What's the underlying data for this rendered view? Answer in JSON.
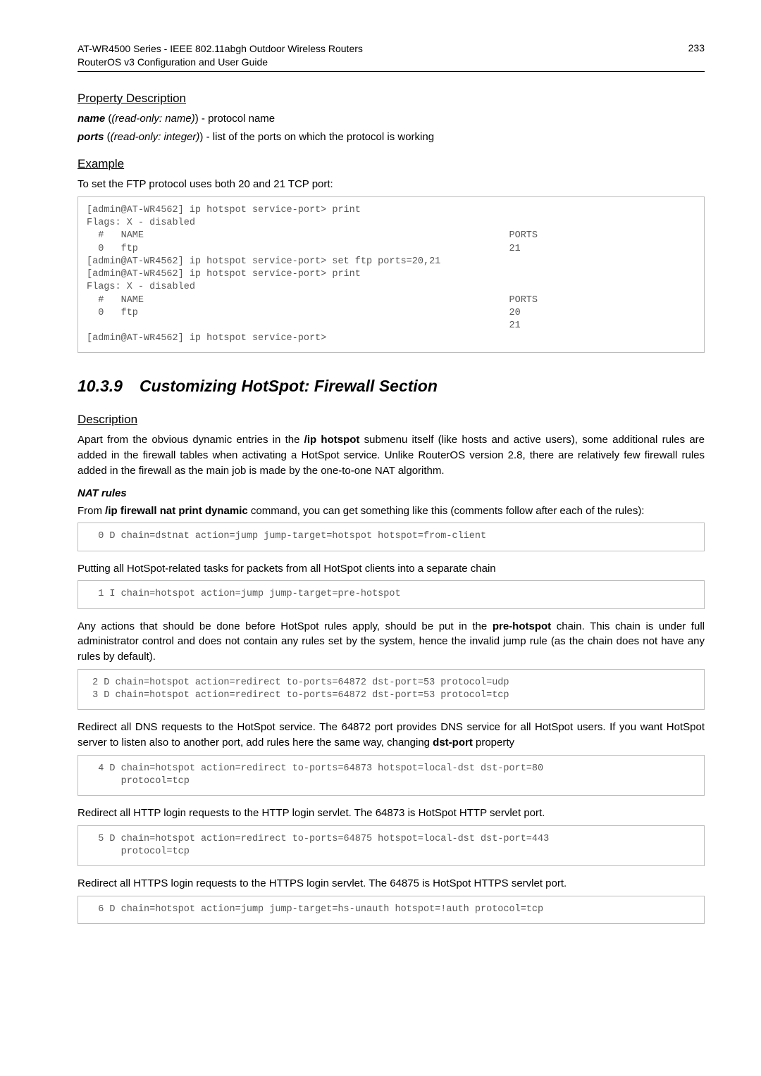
{
  "header": {
    "title_line1": "AT-WR4500 Series - IEEE 802.11abgh Outdoor Wireless Routers",
    "title_line2": "RouterOS v3 Configuration and User Guide",
    "page_number": "233"
  },
  "sec_propdesc": {
    "title": "Property Description",
    "line1_name": "name",
    "line1_paren": "(read-only: name)",
    "line1_rest": " - protocol name",
    "line2_name": "ports",
    "line2_paren": "(read-only: integer)",
    "line2_rest": " - list of the ports on which the protocol is working"
  },
  "sec_example": {
    "title": "Example",
    "intro": "To set the FTP protocol uses both 20 and 21 TCP port:",
    "code": "[admin@AT-WR4562] ip hotspot service-port> print\nFlags: X - disabled\n  #   NAME                                                                PORTS\n  0   ftp                                                                 21\n[admin@AT-WR4562] ip hotspot service-port> set ftp ports=20,21\n[admin@AT-WR4562] ip hotspot service-port> print\nFlags: X - disabled\n  #   NAME                                                                PORTS\n  0   ftp                                                                 20\n                                                                          21\n[admin@AT-WR4562] ip hotspot service-port>"
  },
  "sec_custom": {
    "num": "10.3.9",
    "title": "Customizing HotSpot: Firewall Section"
  },
  "sec_desc": {
    "title": "Description",
    "para_a": "Apart from the obvious dynamic entries in the ",
    "para_b": "/ip hotspot",
    "para_c": " submenu itself (like hosts and active users), some additional rules are added in the firewall tables when activating a HotSpot service. Unlike RouterOS version 2.8, there are relatively few firewall rules added in the firewall as the main job is made by the one-to-one NAT algorithm."
  },
  "sec_nat": {
    "subhead": "NAT rules",
    "intro_a": "From ",
    "intro_b": "/ip firewall nat print dynamic",
    "intro_c": " command, you can get something like this (comments follow after each of the rules):",
    "code0": "  0 D chain=dstnat action=jump jump-target=hotspot hotspot=from-client",
    "text1": "Putting all HotSpot-related tasks for packets from all HotSpot clients into a separate chain",
    "code1": "  1 I chain=hotspot action=jump jump-target=pre-hotspot",
    "text2_a": "Any actions that should be done before HotSpot rules apply, should be put in the ",
    "text2_b": "pre-hotspot",
    "text2_c": " chain. This chain is under full administrator control and does not contain any rules set by the system, hence the invalid jump rule (as the chain does not have any rules by default).",
    "code2": " 2 D chain=hotspot action=redirect to-ports=64872 dst-port=53 protocol=udp\n 3 D chain=hotspot action=redirect to-ports=64872 dst-port=53 protocol=tcp",
    "text3_a": "Redirect all DNS requests to the HotSpot service. The 64872 port provides DNS service for all HotSpot users. If you want HotSpot server to listen also to another port, add rules here the same way, changing ",
    "text3_b": "dst-port",
    "text3_c": " property",
    "code3": "  4 D chain=hotspot action=redirect to-ports=64873 hotspot=local-dst dst-port=80\n      protocol=tcp",
    "text4": "Redirect all HTTP login requests to the HTTP login servlet. The 64873 is HotSpot HTTP servlet port.",
    "code4": "  5 D chain=hotspot action=redirect to-ports=64875 hotspot=local-dst dst-port=443\n      protocol=tcp",
    "text5": "Redirect all HTTPS login requests to the HTTPS login servlet. The 64875 is HotSpot HTTPS servlet port.",
    "code5": "  6 D chain=hotspot action=jump jump-target=hs-unauth hotspot=!auth protocol=tcp"
  }
}
